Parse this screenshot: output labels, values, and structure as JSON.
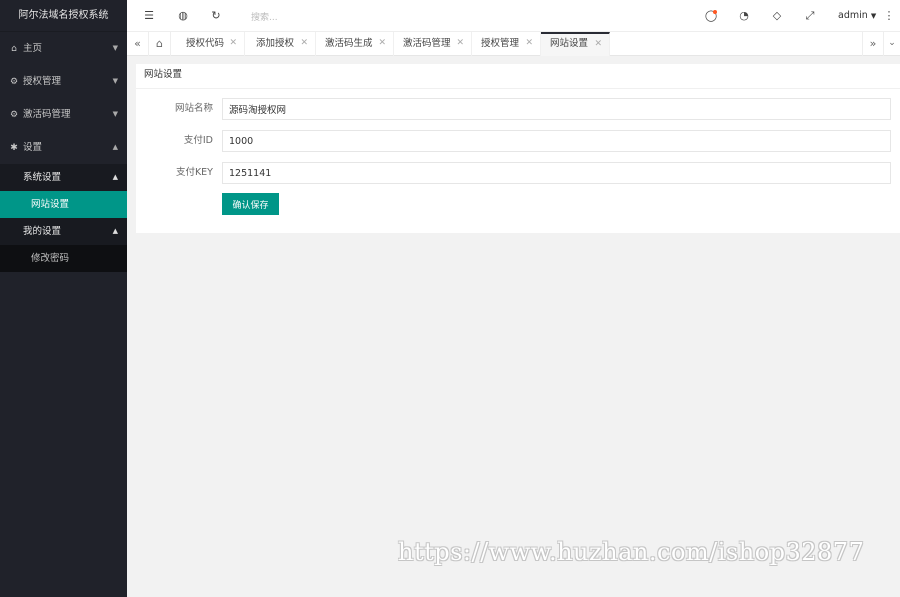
{
  "app": {
    "title": "阿尔法域名授权系统"
  },
  "sidebar": {
    "items": [
      {
        "label": "主页",
        "icon": "home-icon"
      },
      {
        "label": "授权管理",
        "icon": "gear-icon"
      },
      {
        "label": "激活码管理",
        "icon": "gear-icon"
      },
      {
        "label": "设置",
        "icon": "settings-icon"
      }
    ],
    "system_group": "系统设置",
    "website_settings": "网站设置",
    "my_group": "我的设置",
    "change_password": "修改密码"
  },
  "header": {
    "search_placeholder": "搜索...",
    "user": "admin",
    "icons": [
      "menu-toggle-icon",
      "globe-icon",
      "refresh-icon",
      "notification-icon",
      "theme-icon",
      "tag-icon",
      "fullscreen-icon",
      "more-icon"
    ]
  },
  "tabs": {
    "items": [
      {
        "label": "授权代码"
      },
      {
        "label": "添加授权"
      },
      {
        "label": "激活码生成"
      },
      {
        "label": "激活码管理"
      },
      {
        "label": "授权管理"
      },
      {
        "label": "网站设置",
        "active": true
      }
    ]
  },
  "form": {
    "title": "网站设置",
    "site_name_label": "网站名称",
    "site_name_value": "源码淘授权网",
    "pay_id_label": "支付ID",
    "pay_id_value": "1000",
    "pay_key_label": "支付KEY",
    "pay_key_value": "1251141",
    "save_label": "确认保存"
  },
  "watermark": "https://www.huzhan.com/ishop32877",
  "colors": {
    "accent": "#009688",
    "sidebar_bg": "#20222a",
    "notify": "#ff5722"
  }
}
